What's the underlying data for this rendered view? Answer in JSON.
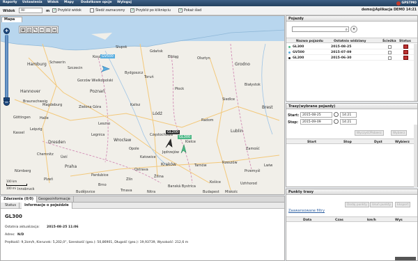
{
  "menu": [
    "Raporty",
    "Ustawienia",
    "Widok",
    "Mapy",
    "Dodatkowe opcje",
    "Wyloguj"
  ],
  "brand": "GPSTMO",
  "toolbar": {
    "widok_label": "Widok",
    "widok_value": "All",
    "m_label": "m",
    "checks": [
      {
        "label": "Przybliż widok",
        "checked": true
      },
      {
        "label": "Śledź zaznaczony",
        "checked": false
      },
      {
        "label": "Przybliż po kliknięciu",
        "checked": true
      },
      {
        "label": "Pokaż ślad",
        "checked": true
      }
    ],
    "user": "demo@Aplikacja DEMO 14:21"
  },
  "map": {
    "tab": "Mapa",
    "places": [
      "Hamburg",
      "Schwerin",
      "Hannover",
      "Poznań",
      "Lódź",
      "Kraków",
      "Wrocław",
      "Katowice",
      "Jędrzejów",
      "Zielona Góra",
      "Gorzów Wielkopolski",
      "Kalisz",
      "Radom",
      "Kielce",
      "Lublin",
      "Zamość",
      "Bydgoszcz",
      "Toruń",
      "Płock",
      "Siedlce",
      "Brest",
      "Grodno",
      "Białystok",
      "Olsztyn",
      "Gdańsk",
      "Elbląg",
      "Koszalin",
      "Słupsk",
      "Szczecin",
      "Leszno",
      "Legnica",
      "Opole",
      "Rzeszów",
      "Tarnów",
      "Przemyśl",
      "Częstochowa",
      "Ostrava",
      "Zlín",
      "Brno",
      "Žilina",
      "Banská Bystrica",
      "Košice",
      "Uzhhorod",
      "Lwiw",
      "Praha",
      "Dresden",
      "Leipzig",
      "Kassel",
      "Göttingen",
      "Halle",
      "Magdeburg",
      "Braunschweig",
      "Chemnitz",
      "Plzeň",
      "Budějovice",
      "Innsbruck",
      "Nürnberg",
      "Budapest",
      "Miskolc",
      "Trnava",
      "Nitra",
      "Ústí",
      "Pardubice"
    ],
    "scale_top": "100 km",
    "scale_bottom": "100 mi",
    "vehicles": [
      {
        "label": "GV500",
        "color": "#5aaee0"
      },
      {
        "label": "GL200",
        "color": "#333333"
      },
      {
        "label": "GL300",
        "color": "#4db886"
      }
    ]
  },
  "bottom": {
    "tabs": [
      "Zdarzenia (0/0)",
      "Geogeoinformacje"
    ],
    "subtabs": [
      "Status",
      "Informacje o pojeździe"
    ],
    "vehicle_name": "GL300",
    "last_update_label": "Ostatnia aktualizacja:",
    "last_update_value": "2015-08-25 11:06",
    "address_label": "Adres:",
    "address_value": "N/D",
    "details": "Prędkość: 9,1km/h, Kierunek: 5,202,0°, Szerokość (geo.): 50,86901, Długość (geo.): 19,93739, Wysokość: 212,6 m"
  },
  "vehicles_panel": {
    "title": "Pojazdy",
    "headers": [
      "Nazwa pojazdu",
      "Ostatnio widziany",
      "Ścieżka",
      "Status"
    ],
    "rows": [
      {
        "name": "GL300",
        "date": "2015-08-25",
        "color": "#4db886"
      },
      {
        "name": "GV500",
        "date": "2015-07-09",
        "color": "#5aaee0"
      },
      {
        "name": "GL200",
        "date": "2015-06-30",
        "color": "#222222"
      }
    ]
  },
  "routes_panel": {
    "title": "Trasy(wybrane pojazdy)",
    "start_label": "Start:",
    "start_date": "2015-08-25",
    "start_time": "14:21",
    "stop_label": "Stop:",
    "stop_date": "2015-09-09",
    "stop_time": "14:21",
    "buttons": [
      "Wyczyść/Pobierz",
      "Wybierz"
    ],
    "headers": [
      "Start",
      "Stop",
      "Dyst",
      "Wybierz"
    ]
  },
  "points_panel": {
    "title": "Punkty trasy",
    "buttons": [
      "Dodaj punkty",
      "Usuń punkty",
      "Eksport"
    ],
    "advanced": "Zaawansowane filtry",
    "headers": [
      "Data",
      "Czas",
      "km/h",
      "Wys"
    ]
  }
}
